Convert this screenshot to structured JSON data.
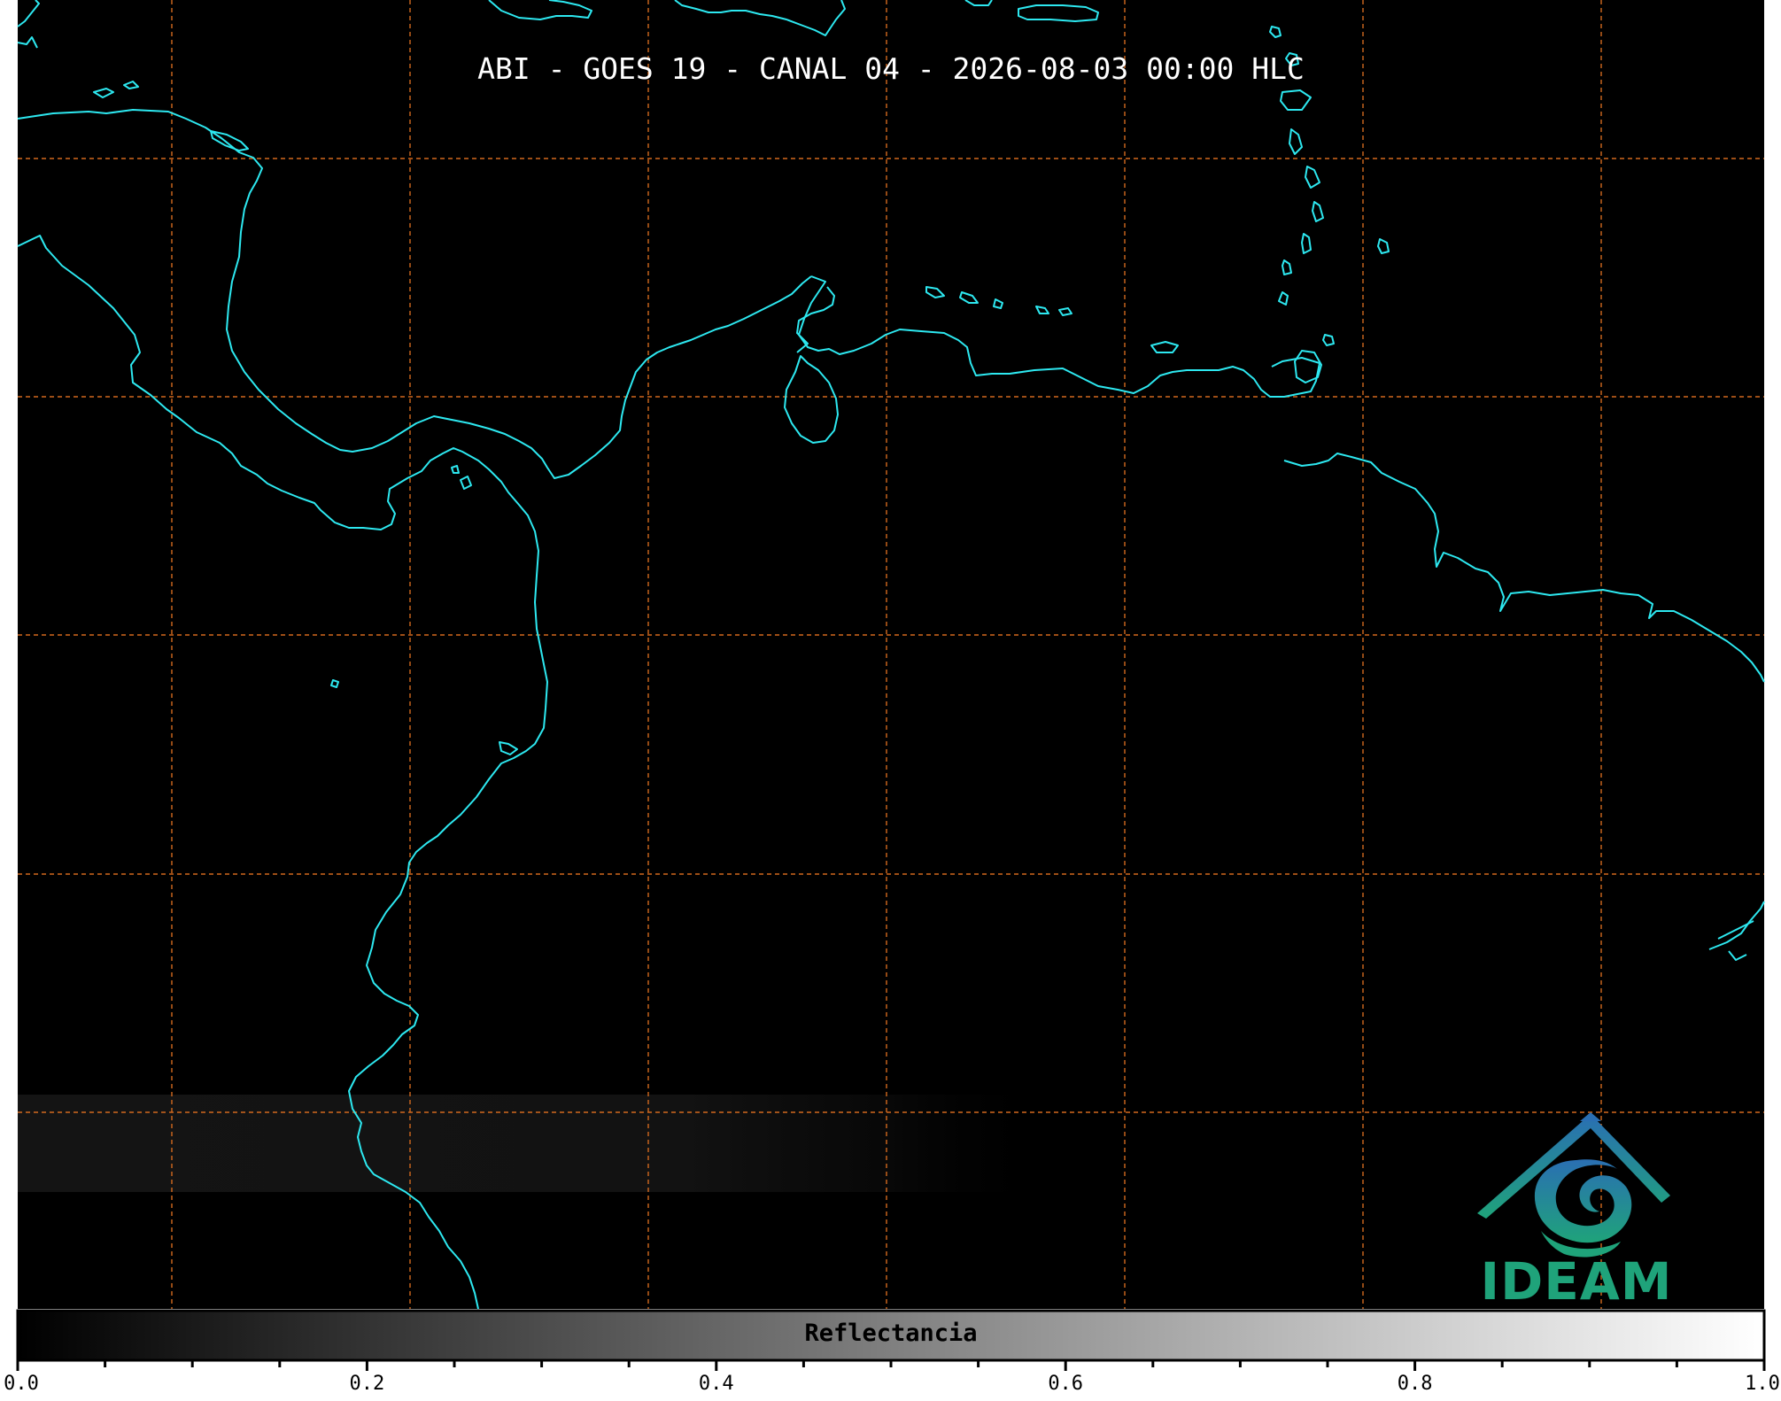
{
  "map": {
    "title": "ABI - GOES 19 - CANAL 04 - 2026-08-03 00:00 HLC"
  },
  "colorbar": {
    "label": "Reflectancia",
    "range": [
      0.0,
      1.0
    ],
    "major_ticks": [
      "0.0",
      "0.2",
      "0.4",
      "0.6",
      "0.8",
      "1.0"
    ],
    "minor_tick_step": 0.05,
    "colormap": "greyscale"
  },
  "logo": {
    "text": "IDEAM"
  },
  "colors": {
    "background": "#000000",
    "coastline": "#2de8f0",
    "gridline": "#d2691e",
    "logo_blue": "#2a6fb3",
    "logo_green": "#1fa37a"
  },
  "gridlines": "dashed, 8 columns x 6 rows"
}
